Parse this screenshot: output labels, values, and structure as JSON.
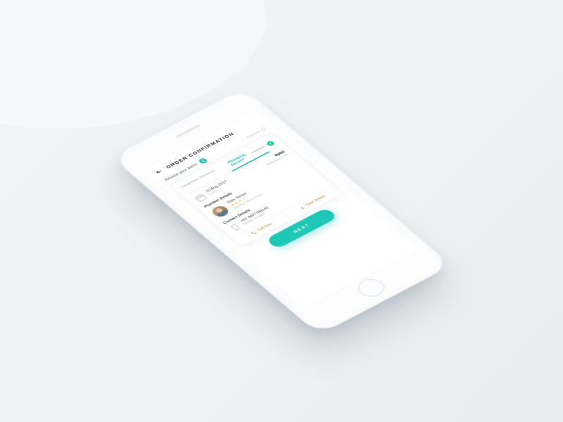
{
  "header": {
    "title": "ORDER CONFIRMATION"
  },
  "review": {
    "label": "Review your items",
    "count": "2",
    "conform_label": "Conform"
  },
  "tabs": {
    "carpenter": "Carpenter Services",
    "plumbing": "Plumbing Service",
    "conform_label": "Conform"
  },
  "schedule": {
    "date": "10 Aug 2017",
    "time": "6 pm"
  },
  "cost": {
    "price": "₹900",
    "label": "Estimated Cost"
  },
  "plumber": {
    "section_title": "Plumber Details",
    "name": "Gary Simon",
    "member_since": "Member Since 2016"
  },
  "contact": {
    "section_title": "Contact Details",
    "phone": "+91 9447784143",
    "phone_label": "Mobile Number"
  },
  "actions": {
    "call": "Call Now",
    "save": "Save Details"
  },
  "cta": {
    "next": "NEXT"
  },
  "colors": {
    "accent": "#1fc7b6",
    "warn": "#c5822c"
  }
}
